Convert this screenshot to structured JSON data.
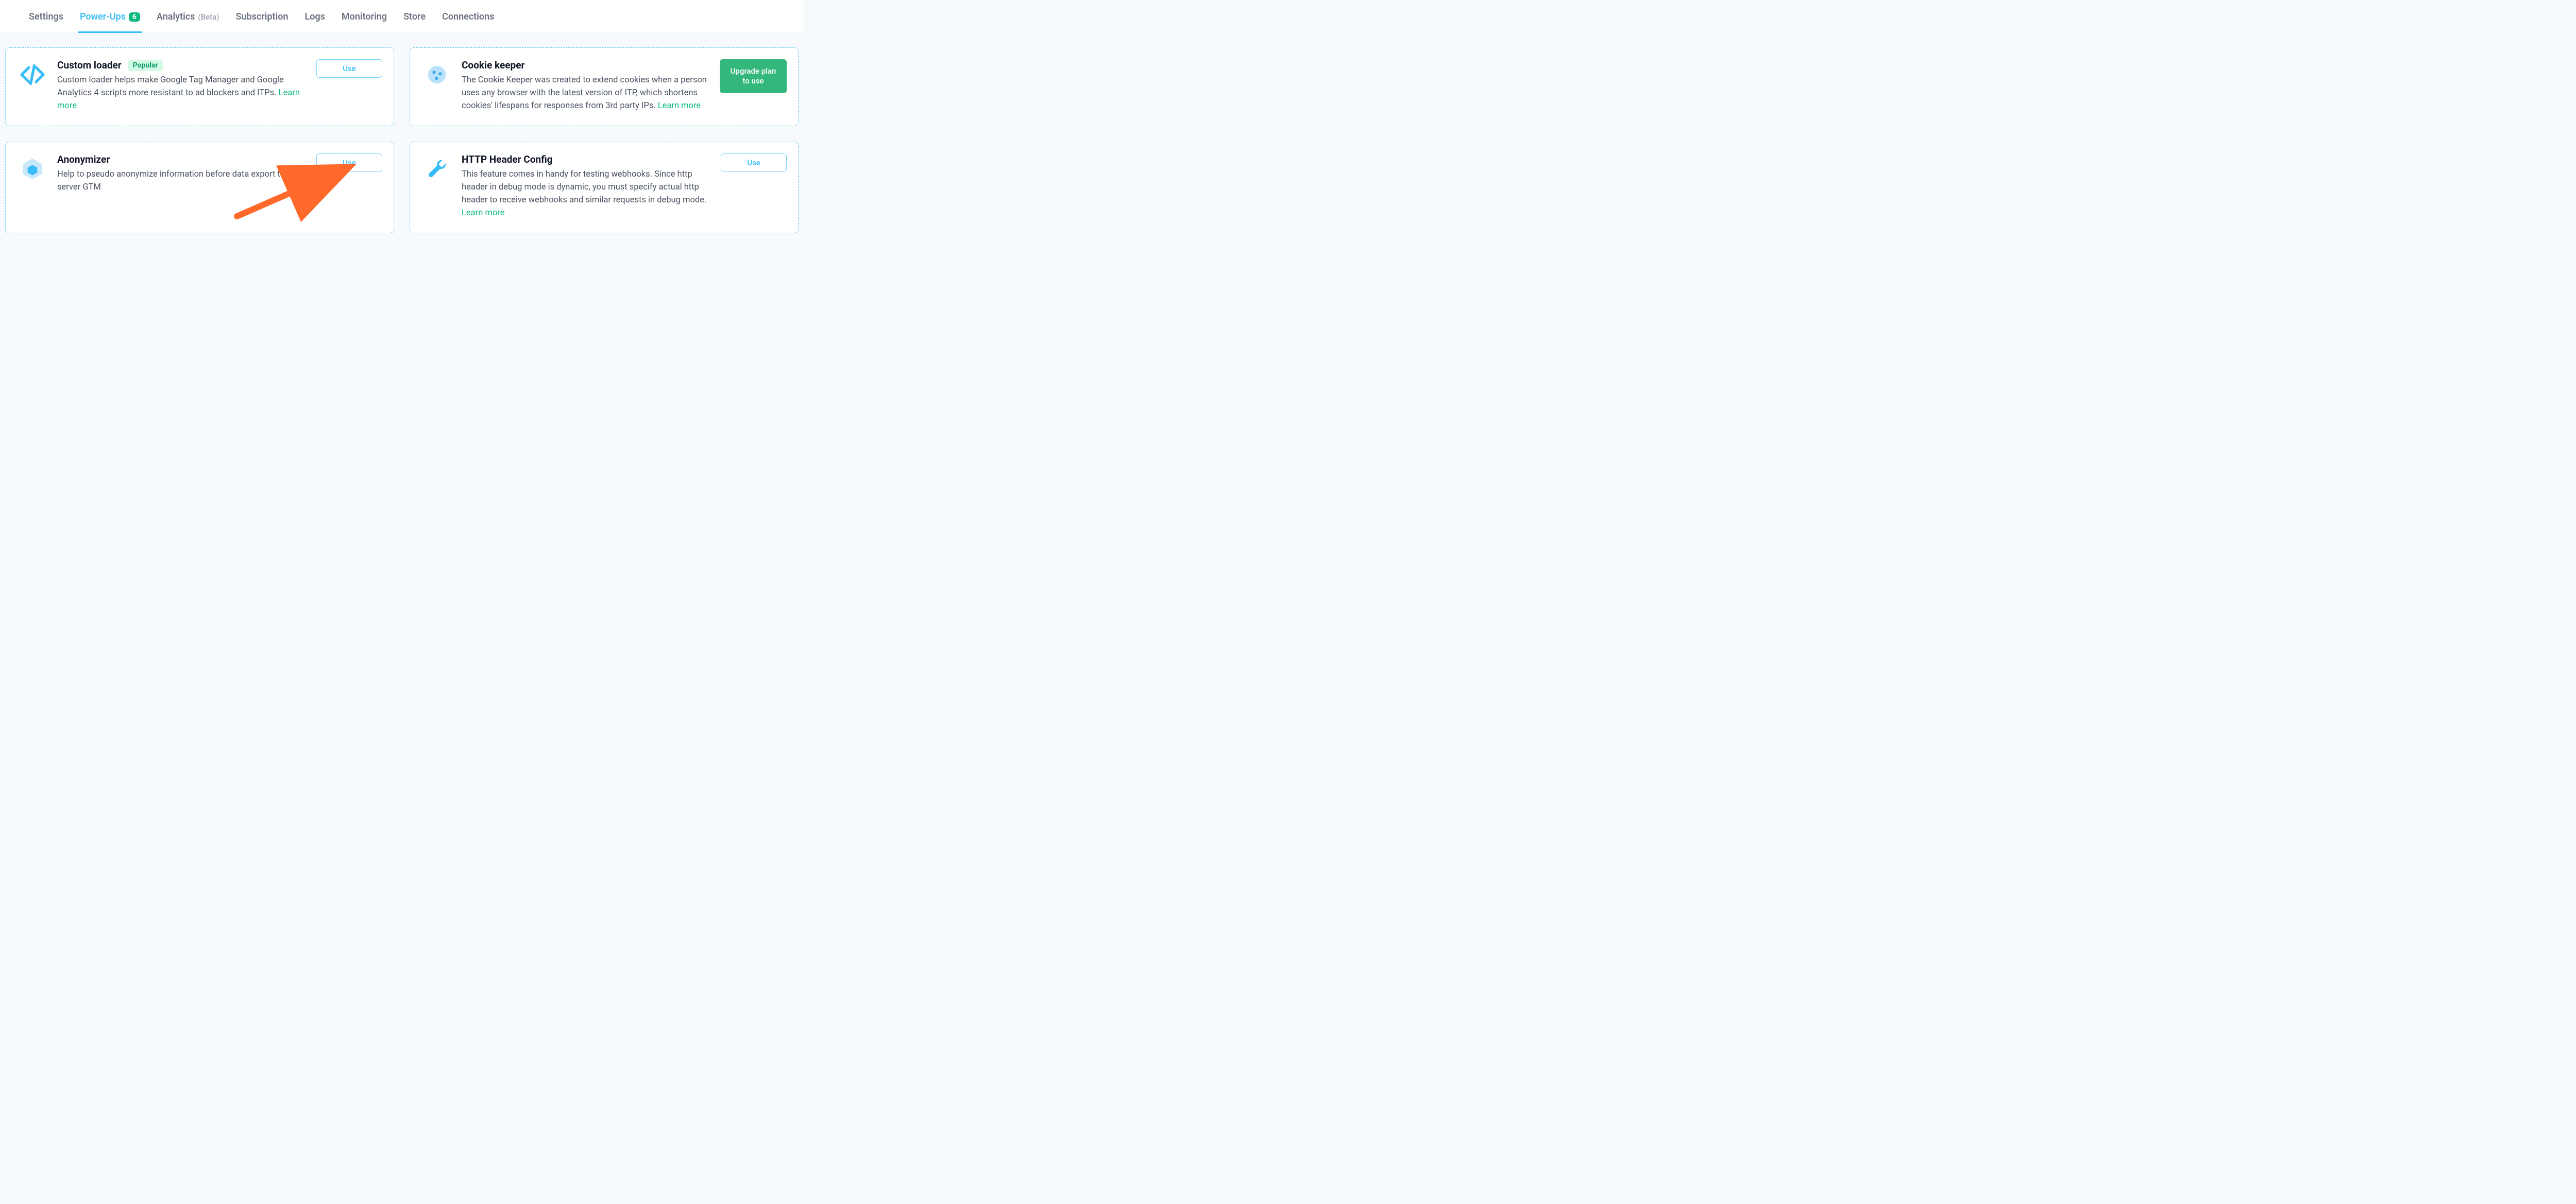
{
  "tabs": [
    {
      "label": "Settings",
      "active": false
    },
    {
      "label": "Power-Ups",
      "active": true,
      "badge": "6"
    },
    {
      "label": "Analytics",
      "active": false,
      "suffix": "(Beta)"
    },
    {
      "label": "Subscription",
      "active": false
    },
    {
      "label": "Logs",
      "active": false
    },
    {
      "label": "Monitoring",
      "active": false
    },
    {
      "label": "Store",
      "active": false
    },
    {
      "label": "Connections",
      "active": false
    }
  ],
  "buttons": {
    "use": "Use",
    "upgrade": "Upgrade plan to use"
  },
  "cards": {
    "custom_loader": {
      "title": "Custom loader",
      "tag": "Popular",
      "desc": "Custom loader helps make Google Tag Manager and Google Analytics 4 scripts more resistant to ad blockers and ITPs. ",
      "learn_more": "Learn more"
    },
    "cookie_keeper": {
      "title": "Cookie keeper",
      "desc": "The Cookie Keeper was created to extend cookies when a person uses any browser with the latest version of ITP, which shortens cookies' lifespans for responses from 3rd party IPs. ",
      "learn_more": "Learn more"
    },
    "anonymizer": {
      "title": "Anonymizer",
      "desc": "Help to pseudo anonymize information before data export to server GTM"
    },
    "http_header": {
      "title": "HTTP Header Config",
      "desc": "This feature comes in handy for testing webhooks. Since http header in debug mode is dynamic, you must specify actual http header to receive webhooks and similar requests in debug mode. ",
      "learn_more": "Learn more"
    }
  }
}
